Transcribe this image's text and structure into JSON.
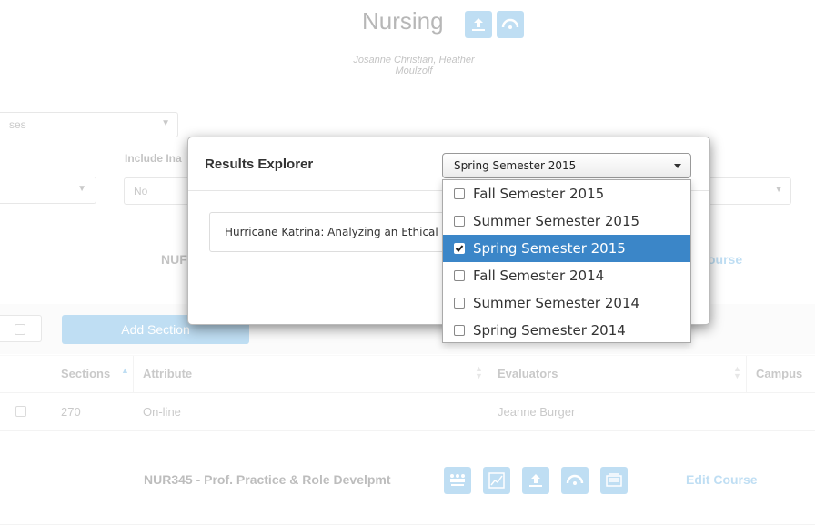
{
  "page": {
    "title": "Nursing",
    "subtitle": "Josanne Christian, Heather Moulzolf"
  },
  "filters": {
    "courses_partial": "ses",
    "include_inactive_label": "Include Ina",
    "include_inactive_value": "No"
  },
  "course1": {
    "code_partial": "NUF",
    "edit_partial": "ourse"
  },
  "section_toolbar": {
    "add_section": "Add Section"
  },
  "table": {
    "headers": [
      "Sections",
      "Attribute",
      "Evaluators",
      "Campus"
    ],
    "rows": [
      {
        "sections": "270",
        "attribute": "On-line",
        "evaluators": "Jeanne Burger"
      }
    ]
  },
  "course2": {
    "title": "NUR345 - Prof. Practice & Role Develpmt",
    "edit_course": "Edit Course"
  },
  "modal": {
    "title": "Results Explorer",
    "selected_term": "Spring Semester 2015",
    "assignment_partial": "Hurricane Katrina: Analyzing an Ethical",
    "terms": [
      {
        "label": "Fall Semester 2015",
        "checked": false
      },
      {
        "label": "Summer Semester 2015",
        "checked": false
      },
      {
        "label": "Spring Semester 2015",
        "checked": true
      },
      {
        "label": "Fall Semester 2014",
        "checked": false
      },
      {
        "label": "Summer Semester 2014",
        "checked": false
      },
      {
        "label": "Spring Semester 2014",
        "checked": false
      }
    ]
  },
  "colors": {
    "accent": "#4aa3df",
    "selected": "#3b86c8"
  }
}
